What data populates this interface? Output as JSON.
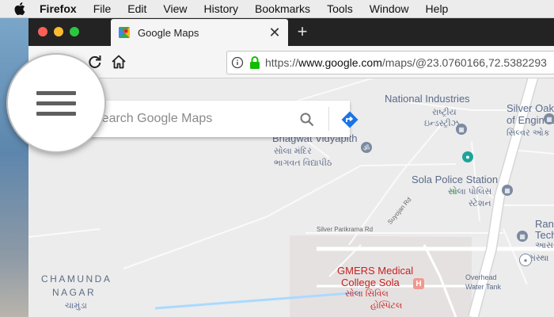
{
  "menubar": {
    "app": "Firefox",
    "items": [
      "File",
      "Edit",
      "View",
      "History",
      "Bookmarks",
      "Tools",
      "Window",
      "Help"
    ]
  },
  "tab": {
    "title": "Google Maps"
  },
  "urlbar": {
    "scheme": "https://",
    "host": "www.google.com",
    "path": "/maps/@23.0760166,72.5382293"
  },
  "search": {
    "placeholder": "Search Google Maps"
  },
  "map": {
    "labels": {
      "national_industries": "National Industries",
      "rashtriya_gj": "રાષ્ટ્રીય",
      "industries_gj": "ઇન્ડસ્ટ્રીઝ",
      "silver_oak": "Silver Oak",
      "of_engineering": "of Engineering",
      "silver_gj": "સિલ્વર ઓક",
      "mandir": "adir",
      "bhagwat_vidyapith": "Bhagwat Vidyapith",
      "sola_mandir_gj": "સોલા મંદિર",
      "bhagwat_gj": "ભાગવત વિદ્યાપીઠ",
      "sola_police_station": "Sola Police Station",
      "sola_police_gj": "સોલા પોલિસ",
      "station_gj": "સ્ટેશન",
      "silver_parikrama_rd": "Silver Parikrama Rd",
      "suyojan_rd": "Suyojan Rd",
      "ranc": "Ranc",
      "tech": "Tech",
      "aasar_gj": "આસર",
      "sanstha_gj": "સંસ્થા",
      "gmers": "GMERS Medical",
      "college_sola": "College Sola",
      "sola_civil_gj": "સોલા સિવિલ",
      "hospital_gj": "હોસ્પિટલ",
      "overhead": "Overhead",
      "water_tank": "Water Tank",
      "chamunda": "CHAMUNDA",
      "nagar": "NAGAR",
      "chamunda_gj": "ચામુંડા"
    }
  },
  "colors": {
    "road_main": "#ffffff",
    "map_bg": "#ececec",
    "hospital": "#c5221f",
    "poi": "#5a6a8a",
    "teal_pin": "#1fa39a",
    "directions_blue": "#1a73e8"
  }
}
